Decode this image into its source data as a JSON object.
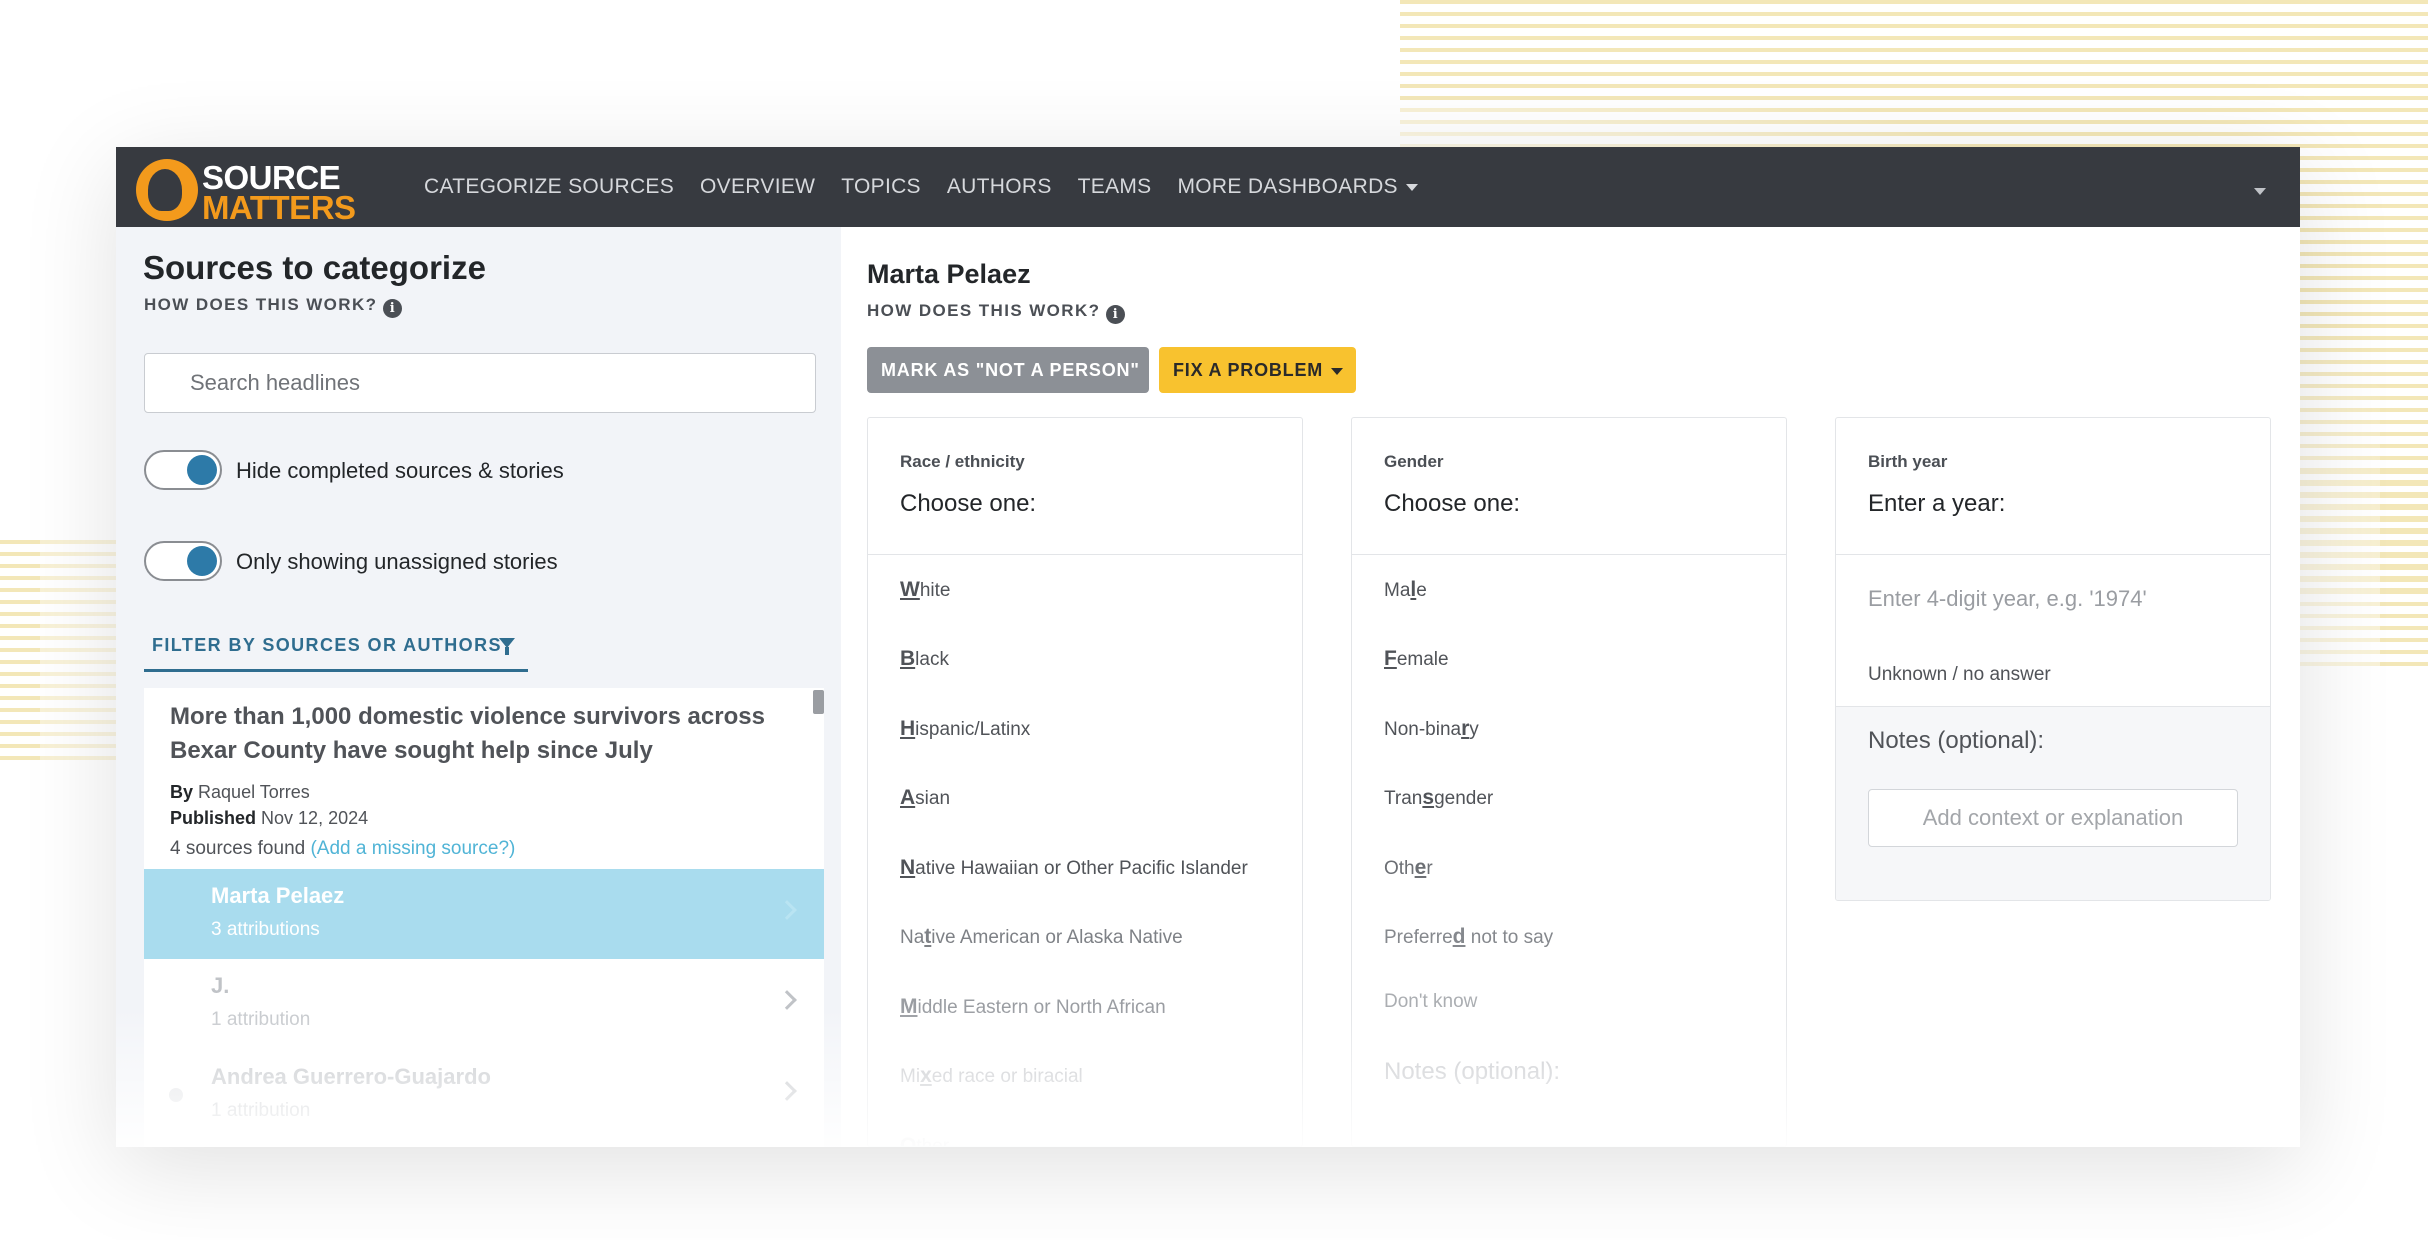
{
  "brand": {
    "logo_line1": "SOURCE",
    "logo_line2": "MATTERS",
    "accent_color": "#f39a1c",
    "navbar_color": "#373a40"
  },
  "nav": {
    "items": [
      "CATEGORIZE SOURCES",
      "OVERVIEW",
      "TOPICS",
      "AUTHORS",
      "TEAMS"
    ],
    "more": "MORE DASHBOARDS"
  },
  "left": {
    "title": "Sources to categorize",
    "how": "HOW DOES THIS WORK?",
    "search_placeholder": "Search headlines",
    "toggles": [
      {
        "label": "Hide completed sources & stories",
        "on": true
      },
      {
        "label": "Only showing unassigned stories",
        "on": true
      }
    ],
    "filter_label": "FILTER BY SOURCES OR AUTHORS",
    "story": {
      "title": "More than 1,000 domestic violence survivors across Bexar County have sought help since July",
      "by_label": "By",
      "author": "Raquel Torres",
      "published_label": "Published",
      "date": "Nov 12, 2024",
      "sources_found": "4 sources found",
      "add_link": "(Add a missing source?)"
    },
    "sources": [
      {
        "name": "Marta Pelaez",
        "count": "3 attributions"
      },
      {
        "name": "J.",
        "count": "1 attribution"
      },
      {
        "name": "Andrea Guerrero-Guajardo",
        "count": "1 attribution"
      }
    ]
  },
  "main": {
    "person": "Marta Pelaez",
    "how": "HOW DOES THIS WORK?",
    "mark_button": "MARK AS \"NOT A PERSON\"",
    "fix_button": "FIX A PROBLEM",
    "race": {
      "label": "Race / ethnicity",
      "prompt": "Choose one:",
      "options": [
        {
          "pre": "",
          "key": "W",
          "post": "hite"
        },
        {
          "pre": "",
          "key": "B",
          "post": "lack"
        },
        {
          "pre": "",
          "key": "H",
          "post": "ispanic/Latinx"
        },
        {
          "pre": "",
          "key": "A",
          "post": "sian"
        },
        {
          "pre": "",
          "key": "N",
          "post": "ative Hawaiian or Other Pacific Islander"
        },
        {
          "pre": "Na",
          "key": "t",
          "post": "ive American or Alaska Native"
        },
        {
          "pre": "",
          "key": "M",
          "post": "iddle Eastern or North African"
        },
        {
          "pre": "Mi",
          "key": "x",
          "post": "ed race or biracial"
        },
        {
          "pre": "",
          "key": "O",
          "post": "ther"
        }
      ]
    },
    "gender": {
      "label": "Gender",
      "prompt": "Choose one:",
      "options": [
        {
          "pre": "Ma",
          "key": "l",
          "post": "e"
        },
        {
          "pre": "",
          "key": "F",
          "post": "emale"
        },
        {
          "pre": "Non-bina",
          "key": "r",
          "post": "y"
        },
        {
          "pre": "Tran",
          "key": "s",
          "post": "gender"
        },
        {
          "pre": "Oth",
          "key": "e",
          "post": "r"
        },
        {
          "pre": "Preferre",
          "key": "d",
          "post": " not to say"
        },
        {
          "pre": "Don't know",
          "key": "",
          "post": ""
        }
      ],
      "notes_label": "Notes (optional):"
    },
    "birth": {
      "label": "Birth year",
      "prompt": "Enter a year:",
      "input_placeholder": "Enter 4-digit year, e.g. '1974'",
      "unknown": "Unknown / no answer",
      "notes_label": "Notes (optional):",
      "notes_placeholder": "Add context or explanation"
    }
  }
}
